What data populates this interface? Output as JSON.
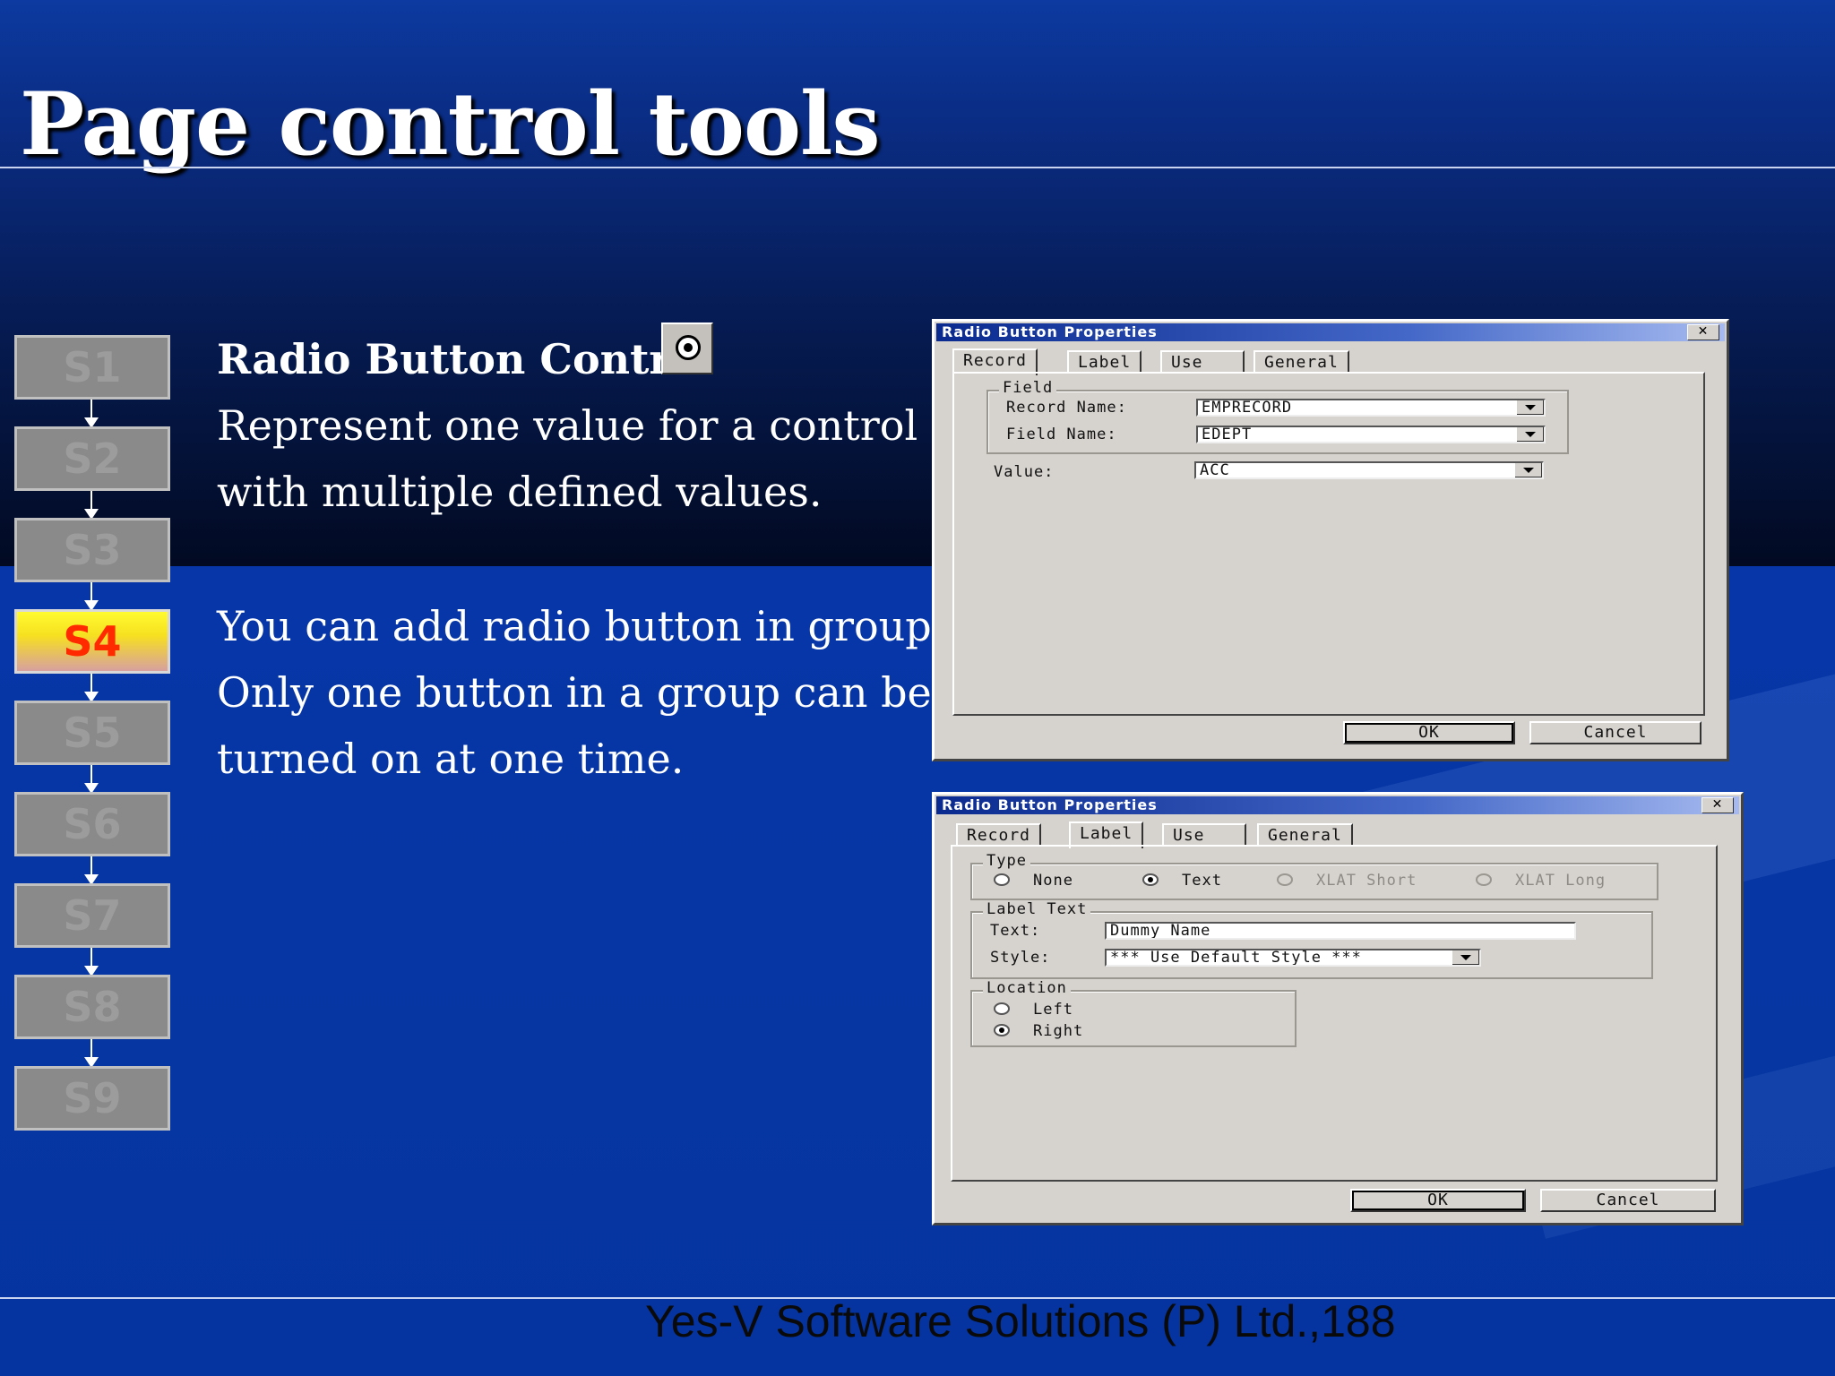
{
  "slide": {
    "title": "Page control tools",
    "footer": "Yes-V Software Solutions (P) Ltd.,188"
  },
  "steps": [
    {
      "label": "S1",
      "active": false
    },
    {
      "label": "S2",
      "active": false
    },
    {
      "label": "S3",
      "active": false
    },
    {
      "label": "S4",
      "active": true
    },
    {
      "label": "S5",
      "active": false
    },
    {
      "label": "S6",
      "active": false
    },
    {
      "label": "S7",
      "active": false
    },
    {
      "label": "S8",
      "active": false
    },
    {
      "label": "S9",
      "active": false
    }
  ],
  "content": {
    "heading": "Radio Button Control",
    "icon": "radio-button-icon",
    "lines": [
      "Represent one value for a control",
      "with multiple defined values.",
      "You can add radio button in groups.",
      "Only one button in a group can be",
      "turned on at one time."
    ]
  },
  "dialog1": {
    "title": "Radio Button Properties",
    "close": "✕",
    "tabs": [
      "Record",
      "Label",
      "Use",
      "General"
    ],
    "field_group": "Field",
    "record_name_label": "Record Name:",
    "record_name_value": "EMPRECORD",
    "field_name_label": "Field Name:",
    "field_name_value": "EDEPT",
    "value_label": "Value:",
    "value_value": "ACC",
    "ok": "OK",
    "cancel": "Cancel"
  },
  "dialog2": {
    "title": "Radio Button Properties",
    "close": "✕",
    "tabs": [
      "Record",
      "Label",
      "Use",
      "General"
    ],
    "type_group": "Type",
    "type_options": [
      "None",
      "Text",
      "XLAT Short",
      "XLAT Long"
    ],
    "type_selected": "Text",
    "label_text_group": "Label Text",
    "text_label": "Text:",
    "text_value": "Dummy Name",
    "style_label": "Style:",
    "style_value": "*** Use Default Style ***",
    "location_group": "Location",
    "location_options": [
      "Left",
      "Right"
    ],
    "location_selected": "Right",
    "ok": "OK",
    "cancel": "Cancel"
  }
}
